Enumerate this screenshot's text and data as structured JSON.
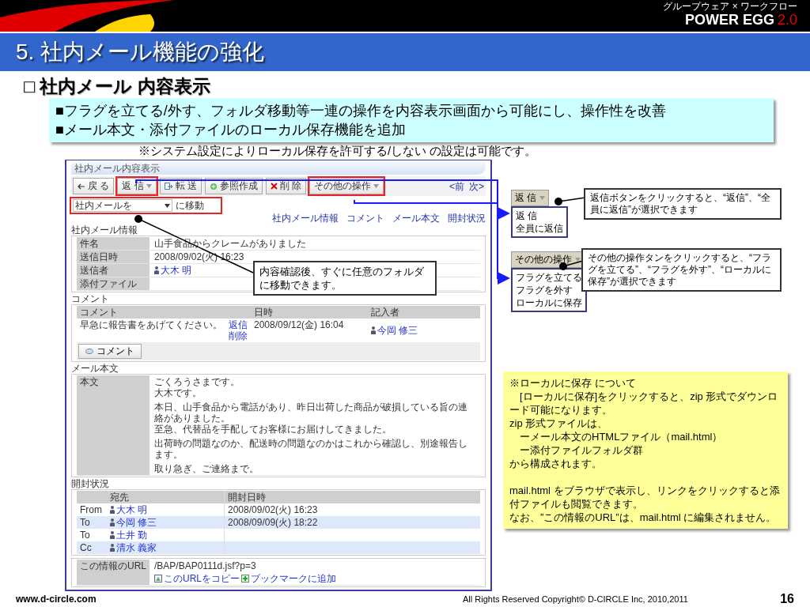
{
  "header": {
    "tagline": "グループウェア × ワークフロー",
    "product": "POWER EGG",
    "version": "2.0"
  },
  "title": "5. 社内メール機能の強化",
  "heading": "□ 社内メール 内容表示",
  "summary": {
    "lines": [
      "■フラグを立てる/外す、フォルダ移動等一連の操作を内容表示画面から可能にし、操作性を改善",
      "■メール本文・添付ファイルのローカル保存機能を追加"
    ],
    "note": "※システム設定によりローカル保存を許可する/しない の設定は可能です。"
  },
  "app": {
    "window_title": "社内メール内容表示",
    "toolbar": [
      {
        "label": "戻 る",
        "dropdown": false,
        "highlighted": false
      },
      {
        "label": "返 信",
        "dropdown": true,
        "highlighted": true
      },
      {
        "label": "転 送",
        "dropdown": false,
        "highlighted": false
      },
      {
        "label": "参照作成",
        "dropdown": false,
        "highlighted": false
      },
      {
        "label": "削 除",
        "dropdown": false,
        "highlighted": false
      },
      {
        "label": "その他の操作",
        "dropdown": true,
        "highlighted": true
      }
    ],
    "nav": [
      "<前",
      "次>"
    ],
    "move": {
      "value": "社内メールを",
      "action": "に移動",
      "highlighted": true
    },
    "anchors": [
      "社内メール情報",
      "コメント",
      "メール本文",
      "開封状況"
    ],
    "info": {
      "title": "社内メール情報",
      "rows": [
        {
          "label": "件名",
          "value": "山手食品からクレームがありました",
          "kind": "text"
        },
        {
          "label": "送信日時",
          "value": "2008/09/02(火) 16:23",
          "kind": "text"
        },
        {
          "label": "送信者",
          "value": "大木 明",
          "kind": "user"
        },
        {
          "label": "添付ファイル",
          "kind": "text"
        }
      ]
    },
    "comments": {
      "title": "コメント",
      "columns": [
        "コメント",
        "日時",
        "記入者"
      ],
      "rows": [
        {
          "comment": "早急に報告書をあげてください。",
          "actions": [
            "返信",
            "削除"
          ],
          "date": "2008/09/12(金) 16:04",
          "author": "今岡 修三"
        }
      ],
      "button": "コメント"
    },
    "body": {
      "title": "メール本文",
      "label": "本文",
      "paragraphs": [
        [
          "ごくろうさまです。",
          "大木です。"
        ],
        [
          "本日、山手食品から電話があり、昨日出荷した商品が破損している旨の連絡がありました。",
          "至急、代替品を手配してお客様にお届けしてきました。"
        ],
        [
          "出荷時の問題なのか、配送時の問題なのかはこれから確認し、別途報告します。"
        ],
        [
          "取り急ぎ、ご連絡まで。"
        ]
      ]
    },
    "open_status": {
      "title": "開封状況",
      "columns": [
        "宛先",
        "開封日時"
      ],
      "rows": [
        {
          "type": "From",
          "name": "大木 明",
          "date": "2008/09/02(火) 16:23",
          "shaded": false
        },
        {
          "type": "To",
          "name": "今岡 修三",
          "date": "2008/09/09(火) 18:22",
          "shaded": true
        },
        {
          "type": "To",
          "name": "土井 勤",
          "shaded": false
        },
        {
          "type": "Cc",
          "name": "清水 義家",
          "shaded": true
        }
      ]
    },
    "url": {
      "label": "この情報のURL",
      "value": "/BAP/BAP0111d.jsf?p=3",
      "links": [
        "このURLをコピー",
        "ブックマークに追加"
      ]
    }
  },
  "reply_menu": {
    "button": "返 信",
    "items": [
      "返 信",
      "全員に返信"
    ]
  },
  "other_menu": {
    "button": "その他の操作",
    "items": [
      "フラグを立てる",
      "フラグを外す",
      "ローカルに保存"
    ]
  },
  "callouts": [
    {
      "kind": "move",
      "text": "内容確認後、すぐに任意のフォルダに移動できます。"
    },
    {
      "kind": "reply",
      "text": "返信ボタンをクリックすると、“返信”、“全員に返信”が選択できます"
    },
    {
      "kind": "other",
      "text": "その他の操作タンをクリックすると、“フラグを立てる”、“フラグを外す”、“ローカルに保存”が選択できます"
    }
  ],
  "note": {
    "paragraphs": [
      [
        "※ローカルに保存 について",
        "　[ローカルに保存]をクリックすると、zip 形式でダウンロード可能になります。",
        "zip 形式ファイルは、",
        "　ーメール本文のHTMLファイル（mail.html）",
        "　ー添付ファイルフォルダ群",
        "から構成されます。"
      ],
      [
        "mail.html をブラウザで表示し、リンクをクリックすると添付ファイルも閲覧できます。",
        "なお、”この情報のURL”は、mail.html に編集されません。"
      ]
    ]
  },
  "footer": {
    "site": "www.d-circle.com",
    "copyright": "All Rights Reserved Copyright© D-CIRCLE Inc, 2010,2011",
    "page": "16"
  }
}
